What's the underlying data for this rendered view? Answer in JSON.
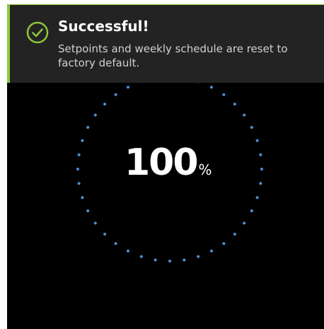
{
  "toast": {
    "title": "Successful!",
    "message": "Setpoints and weekly schedule are reset to factory default.",
    "icon": "check-circle-icon",
    "accent_color": "#8dc63f"
  },
  "progress": {
    "value": "100",
    "unit": "%",
    "fraction": 1.0,
    "dot_color": "#4a90d9"
  }
}
